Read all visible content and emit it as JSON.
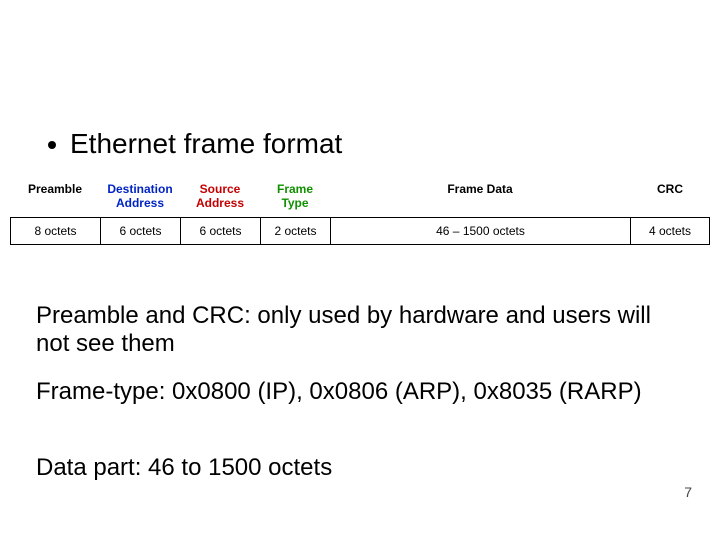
{
  "bullet": "Ethernet frame format",
  "frame": {
    "headers": {
      "preamble": "Preamble",
      "dest": "Destination\nAddress",
      "src": "Source\nAddress",
      "type": "Frame\nType",
      "data": "Frame Data",
      "crc": "CRC"
    },
    "values": {
      "preamble": "8 octets",
      "dest": "6 octets",
      "src": "6 octets",
      "type": "2 octets",
      "data": "46 – 1500 octets",
      "crc": "4 octets"
    }
  },
  "notes": {
    "n1": "Preamble and CRC: only used by hardware and users will not see them",
    "n2": "Frame-type: 0x0800 (IP), 0x0806 (ARP), 0x8035 (RARP)",
    "n3": "Data part: 46 to 1500 octets"
  },
  "page": "7"
}
